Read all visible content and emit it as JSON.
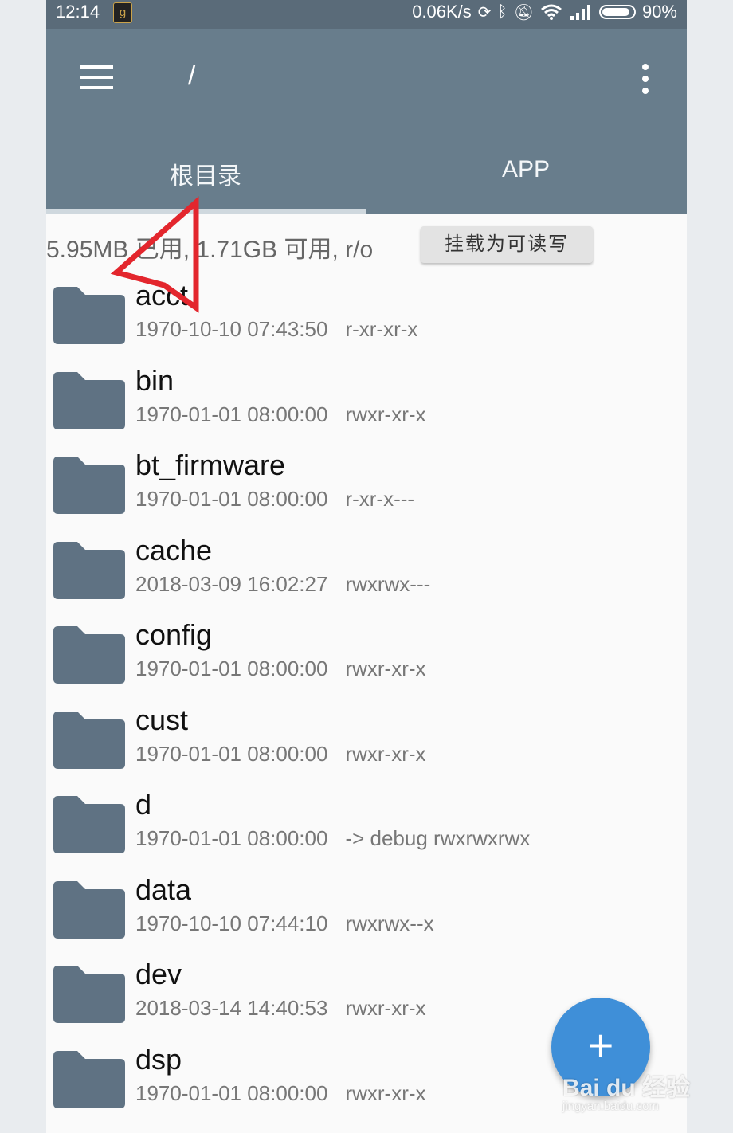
{
  "status_bar": {
    "time": "12:14",
    "notification_icon": "app-notification-icon",
    "net_speed": "0.06K/s",
    "icons": [
      "sync-icon",
      "bluetooth-icon",
      "mute-icon",
      "wifi-icon",
      "signal-icon"
    ],
    "battery_percent": "90%",
    "battery_level": 0.9
  },
  "toolbar": {
    "path": "/",
    "menu_icon": "hamburger-menu-icon",
    "more_icon": "more-vert-icon"
  },
  "tabs": [
    {
      "label": "根目录",
      "selected": true
    },
    {
      "label": "APP",
      "selected": false
    }
  ],
  "storage": {
    "info": "5.95MB 已用, 1.71GB 可用, r/o",
    "mount_button": "挂载为可读写"
  },
  "files": [
    {
      "name": "acct",
      "date": "1970-10-10 07:43:50",
      "perm": "r-xr-xr-x"
    },
    {
      "name": "bin",
      "date": "1970-01-01 08:00:00",
      "perm": "rwxr-xr-x"
    },
    {
      "name": "bt_firmware",
      "date": "1970-01-01 08:00:00",
      "perm": "r-xr-x---"
    },
    {
      "name": "cache",
      "date": "2018-03-09 16:02:27",
      "perm": "rwxrwx---"
    },
    {
      "name": "config",
      "date": "1970-01-01 08:00:00",
      "perm": "rwxr-xr-x"
    },
    {
      "name": "cust",
      "date": "1970-01-01 08:00:00",
      "perm": "rwxr-xr-x"
    },
    {
      "name": "d",
      "date": "1970-01-01 08:00:00",
      "perm": "-> debug  rwxrwxrwx"
    },
    {
      "name": "data",
      "date": "1970-10-10 07:44:10",
      "perm": "rwxrwx--x"
    },
    {
      "name": "dev",
      "date": "2018-03-14 14:40:53",
      "perm": "rwxr-xr-x"
    },
    {
      "name": "dsp",
      "date": "1970-01-01 08:00:00",
      "perm": "rwxr-xr-x"
    }
  ],
  "fab": {
    "label": "+"
  },
  "watermark": {
    "text": "Bai du 经验",
    "sub": "jingyan.baidu.com"
  },
  "colors": {
    "appbar": "#687d8c",
    "statusbar": "#5a6b79",
    "folder": "#5f7283",
    "fab": "#3f8fd8",
    "arrow": "#e3262d"
  }
}
